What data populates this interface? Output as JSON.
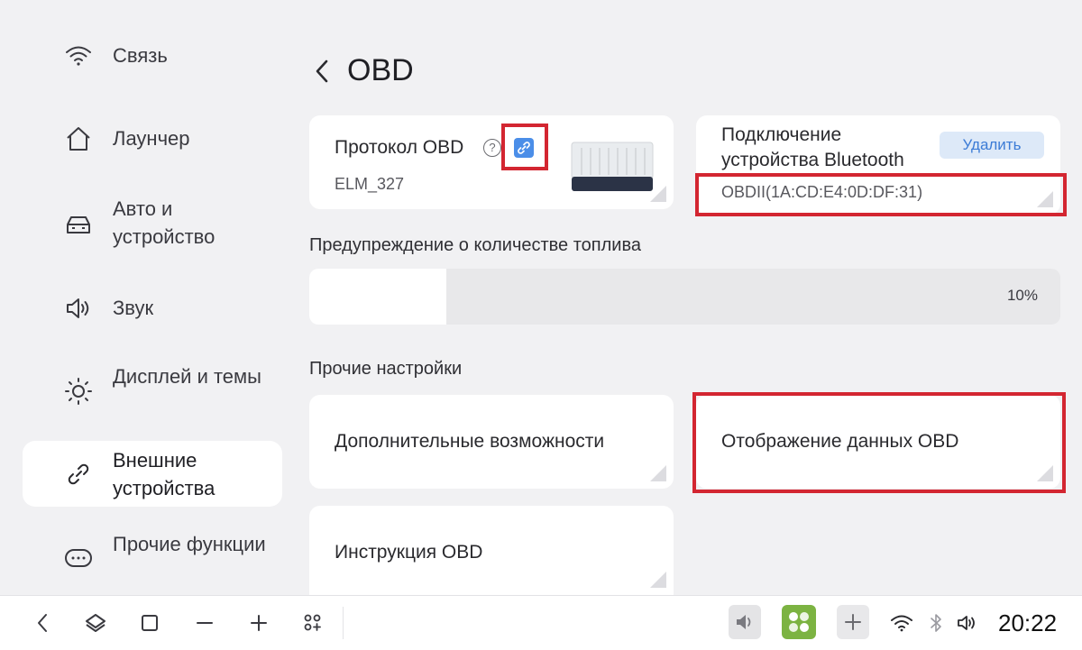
{
  "sidebar": {
    "items": [
      {
        "id": "connection",
        "label": "Связь",
        "icon": "wifi-icon"
      },
      {
        "id": "launcher",
        "label": "Лаунчер",
        "icon": "home-icon"
      },
      {
        "id": "auto",
        "label": "Авто и устройство",
        "icon": "car-icon"
      },
      {
        "id": "sound",
        "label": "Звук",
        "icon": "speaker-icon"
      },
      {
        "id": "display",
        "label": "Дисплей и темы",
        "icon": "sun-icon"
      },
      {
        "id": "external",
        "label": "Внешние устройства",
        "icon": "link-icon",
        "active": true
      },
      {
        "id": "other",
        "label": "Прочие функции",
        "icon": "more-icon"
      }
    ]
  },
  "header": {
    "title": "OBD"
  },
  "protocol_card": {
    "title": "Протокол OBD",
    "value": "ELM_327"
  },
  "bluetooth_card": {
    "title": "Подключение устройства Bluetooth",
    "device": "OBDII(1A:CD:E4:0D:DF:31)",
    "delete_label": "Удалить"
  },
  "fuel": {
    "label": "Предупреждение о количестве топлива",
    "value_text": "10%",
    "level_fraction": 0.1
  },
  "other_settings": {
    "label": "Прочие настройки",
    "extra_features": "Дополнительные возможности",
    "obd_display": "Отображение данных OBD",
    "obd_manual": "Инструкция OBD"
  },
  "taskbar": {
    "time": "20:22"
  },
  "colors": {
    "accent": "#4b8ee8",
    "highlight": "#d32631",
    "app_tile": "#7cb342"
  }
}
